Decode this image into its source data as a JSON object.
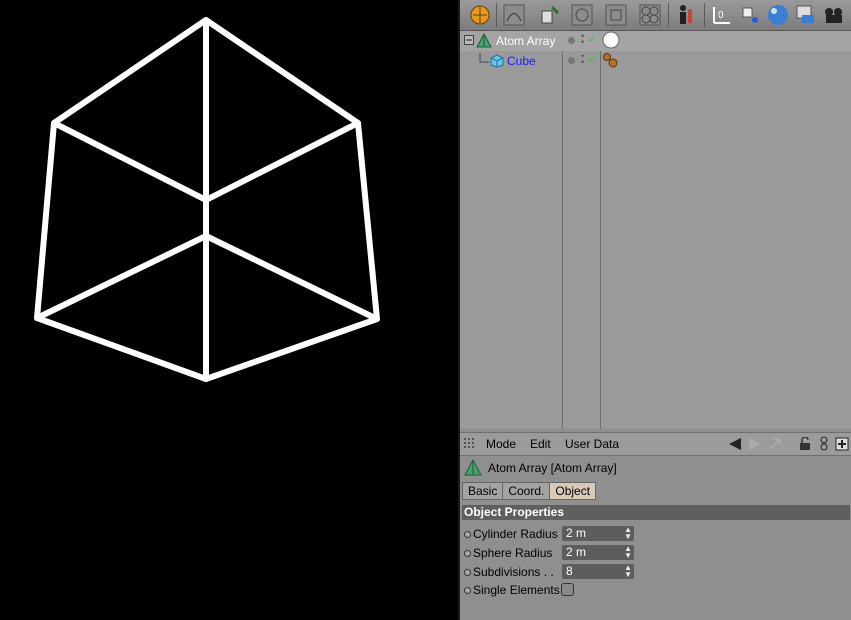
{
  "viewport": {
    "background": "#000000",
    "wire_color": "#ffffff",
    "object": "cube-wireframe"
  },
  "toolbar": {
    "icons": [
      "cube-primitive-icon",
      "spline-icon",
      "nurbs-icon",
      "array-icon",
      "deformer-icon",
      "atom-icon",
      "character-icon",
      "coordinate-icon",
      "scene-icon",
      "sphere-material-icon",
      "floor-icon",
      "camera-icon"
    ]
  },
  "object_manager": {
    "objects": [
      {
        "name": "Atom Array",
        "color": "#ffffff",
        "icon": "atom-array-icon",
        "tag": "white-sphere-tag"
      },
      {
        "name": "Cube",
        "color": "#1a1aff",
        "icon": "cube-icon",
        "tag": "material-tag"
      }
    ]
  },
  "attributes": {
    "menu": [
      "Mode",
      "Edit",
      "User Data"
    ],
    "title": "Atom Array [Atom Array]",
    "tabs": [
      "Basic",
      "Coord.",
      "Object"
    ],
    "active_tab": "Object",
    "section": "Object Properties",
    "props": [
      {
        "label": "Cylinder Radius",
        "value": "2 m"
      },
      {
        "label": "Sphere Radius",
        "value": "2 m"
      },
      {
        "label": "Subdivisions  . .",
        "value": "8"
      },
      {
        "label": "Single Elements",
        "checked": false
      }
    ]
  },
  "colors": {
    "panel": "#8f8f8f",
    "section_header": "#5f5f5f",
    "active_tab": "#d8c9b8",
    "enabled_check": "#2ecc40"
  }
}
